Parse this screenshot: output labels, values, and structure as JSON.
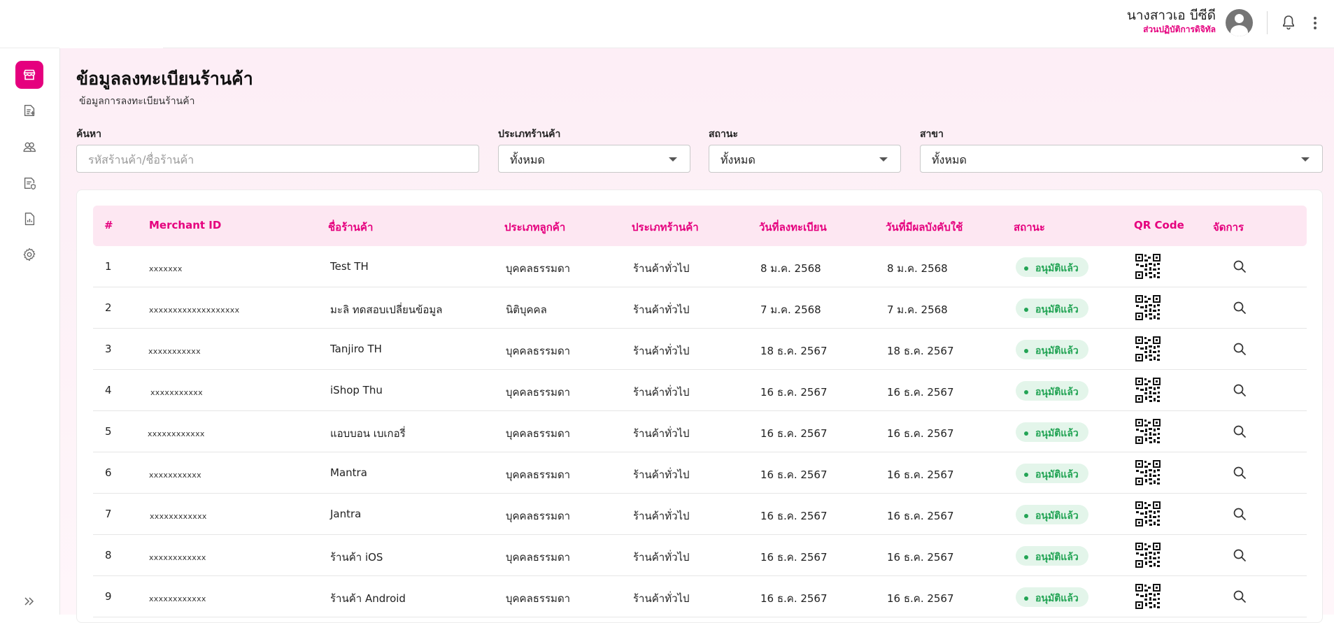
{
  "header": {
    "user_name": "นางสาวเอ บีซีดี",
    "user_role": "ส่วนปฏิบัติการดิจิทัล"
  },
  "sidebar": {
    "items": [
      {
        "icon": "store-icon",
        "active": true
      },
      {
        "icon": "document-add-icon",
        "active": false
      },
      {
        "icon": "users-icon",
        "active": false
      },
      {
        "icon": "verified-document-icon",
        "active": false
      },
      {
        "icon": "report-icon",
        "active": false
      },
      {
        "icon": "gear-icon",
        "active": false
      }
    ]
  },
  "page": {
    "title": "ข้อมูลลงทะเบียนร้านค้า",
    "subtitle": "ข้อมูลการลงทะเบียนร้านค้า"
  },
  "filters": {
    "search_label": "ค้นหา",
    "search_placeholder": "รหัสร้านค้า/ชื่อร้านค้า",
    "store_type_label": "ประเภทร้านค้า",
    "store_type_value": "ทั้งหมด",
    "status_label": "สถานะ",
    "status_value": "ทั้งหมด",
    "branch_label": "สาขา",
    "branch_value": "ทั้งหมด"
  },
  "table": {
    "columns": [
      "#",
      "Merchant ID",
      "ชื่อร้านค้า",
      "ประเภทลูกค้า",
      "ประเภทร้านค้า",
      "วันที่ลงทะเบียน",
      "วันที่มีผลบังคับใช้",
      "สถานะ",
      "QR Code",
      "จัดการ"
    ],
    "rows": [
      {
        "no": "1",
        "merchant_id": "xxxxxxx",
        "name": "Test TH",
        "customer_type": "บุคคลธรรมดา",
        "store_type": "ร้านค้าทั่วไป",
        "registered": "8 ม.ค. 2568",
        "effective": "8 ม.ค. 2568",
        "status": "อนุมัติแล้ว"
      },
      {
        "no": "2",
        "merchant_id": "xxxxxxxxxxxxxxxxxxx",
        "name": "มะลิ ทดสอบเปลี่ยนข้อมูล",
        "customer_type": "นิติบุคคล",
        "store_type": "ร้านค้าทั่วไป",
        "registered": "7 ม.ค. 2568",
        "effective": "7 ม.ค. 2568",
        "status": "อนุมัติแล้ว"
      },
      {
        "no": "3",
        "merchant_id": "xxxxxxxxxxx",
        "name": "Tanjiro TH",
        "customer_type": "บุคคลธรรมดา",
        "store_type": "ร้านค้าทั่วไป",
        "registered": "18 ธ.ค. 2567",
        "effective": "18 ธ.ค. 2567",
        "status": "อนุมัติแล้ว"
      },
      {
        "no": "4",
        "merchant_id": "xxxxxxxxxxx",
        "name": "iShop Thu",
        "customer_type": "บุคคลธรรมดา",
        "store_type": "ร้านค้าทั่วไป",
        "registered": "16 ธ.ค. 2567",
        "effective": "16 ธ.ค. 2567",
        "status": "อนุมัติแล้ว"
      },
      {
        "no": "5",
        "merchant_id": "xxxxxxxxxxxx",
        "name": "แอบบอน เบเกอรี่",
        "customer_type": "บุคคลธรรมดา",
        "store_type": "ร้านค้าทั่วไป",
        "registered": "16 ธ.ค. 2567",
        "effective": "16 ธ.ค. 2567",
        "status": "อนุมัติแล้ว"
      },
      {
        "no": "6",
        "merchant_id": "xxxxxxxxxxx",
        "name": "Mantra",
        "customer_type": "บุคคลธรรมดา",
        "store_type": "ร้านค้าทั่วไป",
        "registered": "16 ธ.ค. 2567",
        "effective": "16 ธ.ค. 2567",
        "status": "อนุมัติแล้ว"
      },
      {
        "no": "7",
        "merchant_id": "xxxxxxxxxxxx",
        "name": "Jantra",
        "customer_type": "บุคคลธรรมดา",
        "store_type": "ร้านค้าทั่วไป",
        "registered": "16 ธ.ค. 2567",
        "effective": "16 ธ.ค. 2567",
        "status": "อนุมัติแล้ว"
      },
      {
        "no": "8",
        "merchant_id": "xxxxxxxxxxxx",
        "name": "ร้านค้า iOS",
        "customer_type": "บุคคลธรรมดา",
        "store_type": "ร้านค้าทั่วไป",
        "registered": "16 ธ.ค. 2567",
        "effective": "16 ธ.ค. 2567",
        "status": "อนุมัติแล้ว"
      },
      {
        "no": "9",
        "merchant_id": "xxxxxxxxxxxx",
        "name": "ร้านค้า Android",
        "customer_type": "บุคคลธรรมดา",
        "store_type": "ร้านค้าทั่วไป",
        "registered": "16 ธ.ค. 2567",
        "effective": "16 ธ.ค. 2567",
        "status": "อนุมัติแล้ว"
      }
    ]
  },
  "colors": {
    "accent": "#e5007e",
    "header_bg": "#fde7f2",
    "status_green": "#23a455",
    "status_green_bg": "#e3f5ea"
  }
}
